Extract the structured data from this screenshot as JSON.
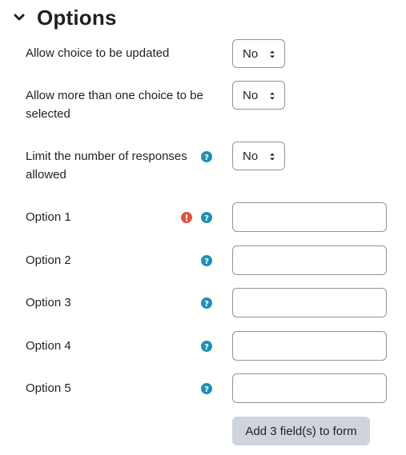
{
  "section": {
    "title": "Options"
  },
  "fields": {
    "allow_update": {
      "label": "Allow choice to be updated",
      "value": "No"
    },
    "allow_multiple": {
      "label": "Allow more than one choice to be selected",
      "value": "No"
    },
    "limit_answers": {
      "label": "Limit the number of responses allowed",
      "value": "No"
    },
    "options": [
      {
        "label": "Option 1",
        "value": ""
      },
      {
        "label": "Option 2",
        "value": ""
      },
      {
        "label": "Option 3",
        "value": ""
      },
      {
        "label": "Option 4",
        "value": ""
      },
      {
        "label": "Option 5",
        "value": ""
      }
    ]
  },
  "actions": {
    "add_fields_label": "Add 3 field(s) to form"
  },
  "icons": {
    "help": "help-circle-icon",
    "required": "required-error-icon",
    "collapse": "chevron-down-icon"
  },
  "colors": {
    "help": "#1f8fb3",
    "required": "#e0533b",
    "button_bg": "#ced4da",
    "border": "#8f959e",
    "text": "#1d2125"
  }
}
